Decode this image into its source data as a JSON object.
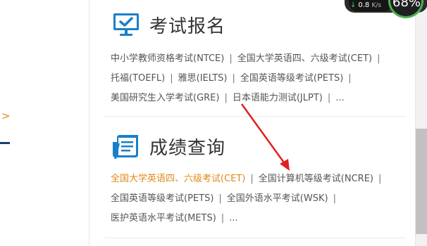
{
  "sections": [
    {
      "title": "考试报名",
      "icon": "computer-monitor-check-icon",
      "lines": [
        {
          "links": [
            {
              "label": "中小学教师资格考试(NTCE)"
            },
            {
              "label": "全国大学英语四、六级考试(CET)"
            }
          ],
          "trailing_separator": true
        },
        {
          "links": [
            {
              "label": "托福(TOEFL)"
            },
            {
              "label": "雅思(IELTS)"
            },
            {
              "label": "全国英语等级考试(PETS)"
            }
          ],
          "trailing_separator": true
        },
        {
          "links": [
            {
              "label": "美国研究生入学考试(GRE)"
            },
            {
              "label": "日本语能力测试(JLPT)"
            },
            {
              "label": "..."
            }
          ],
          "trailing_separator": false
        }
      ]
    },
    {
      "title": "成绩查询",
      "icon": "document-pen-icon",
      "lines": [
        {
          "links": [
            {
              "label": "全国大学英语四、六级考试(CET)",
              "highlighted": true
            },
            {
              "label": "全国计算机等级考试(NCRE)"
            }
          ],
          "trailing_separator": true
        },
        {
          "links": [
            {
              "label": "全国英语等级考试(PETS)"
            },
            {
              "label": "全国外语水平考试(WSK)"
            }
          ],
          "trailing_separator": true
        },
        {
          "links": [
            {
              "label": "医护英语水平考试(METS)"
            },
            {
              "label": "..."
            }
          ],
          "trailing_separator": false
        }
      ]
    }
  ],
  "separator": "|",
  "left_fragment": {
    "chevron": ">"
  },
  "network_widget": {
    "arrow": "↓",
    "speed": "0.8",
    "unit": "K/s",
    "percent": "68%"
  },
  "colors": {
    "accent": "#e08a17",
    "icon_blue": "#1a7fc8",
    "text": "#555555",
    "annotation_arrow": "#e02020"
  }
}
